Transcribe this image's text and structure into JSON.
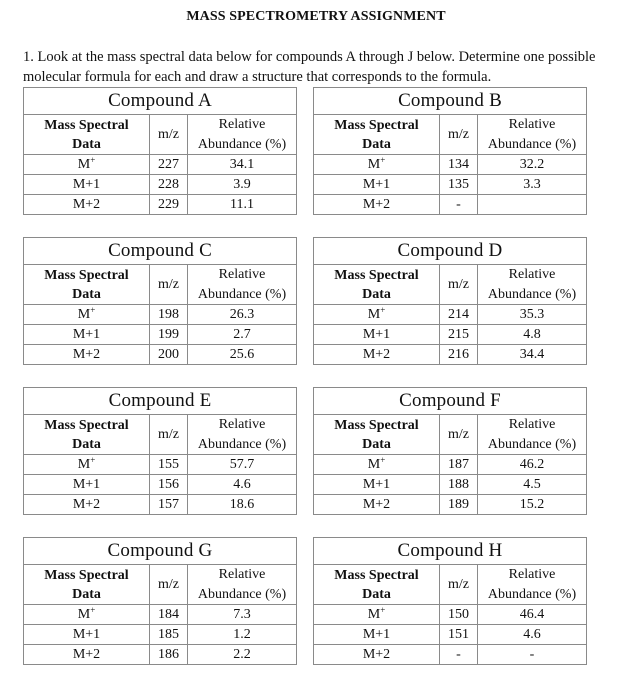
{
  "document": {
    "title": "MASS SPECTROMETRY ASSIGNMENT",
    "instructions": [
      "1. Look at the mass spectral data below for compounds A through J below.  Determine one possible",
      "molecular formula for each and draw a structure that corresponds to the formula."
    ]
  },
  "table_headers": {
    "col1_line1": "Mass Spectral",
    "col1_line2": "Data",
    "col2": "m/z",
    "col3_line1": "Relative",
    "col3_line2": "Abundance (%)"
  },
  "row_labels": {
    "m_base": "M",
    "m_sup": "+",
    "m1": "M+1",
    "m2": "M+2"
  },
  "compounds": [
    {
      "name": "Compound A",
      "rows": [
        {
          "mz": "227",
          "abundance": "34.1"
        },
        {
          "mz": "228",
          "abundance": "3.9"
        },
        {
          "mz": "229",
          "abundance": "11.1"
        }
      ]
    },
    {
      "name": "Compound B",
      "rows": [
        {
          "mz": "134",
          "abundance": "32.2"
        },
        {
          "mz": "135",
          "abundance": "3.3"
        },
        {
          "mz": "-",
          "abundance": ""
        }
      ]
    },
    {
      "name": "Compound C",
      "rows": [
        {
          "mz": "198",
          "abundance": "26.3"
        },
        {
          "mz": "199",
          "abundance": "2.7"
        },
        {
          "mz": "200",
          "abundance": "25.6"
        }
      ]
    },
    {
      "name": "Compound D",
      "rows": [
        {
          "mz": "214",
          "abundance": "35.3"
        },
        {
          "mz": "215",
          "abundance": "4.8"
        },
        {
          "mz": "216",
          "abundance": "34.4"
        }
      ]
    },
    {
      "name": "Compound E",
      "rows": [
        {
          "mz": "155",
          "abundance": "57.7"
        },
        {
          "mz": "156",
          "abundance": "4.6"
        },
        {
          "mz": "157",
          "abundance": "18.6"
        }
      ]
    },
    {
      "name": "Compound F",
      "rows": [
        {
          "mz": "187",
          "abundance": "46.2"
        },
        {
          "mz": "188",
          "abundance": "4.5"
        },
        {
          "mz": "189",
          "abundance": "15.2"
        }
      ]
    },
    {
      "name": "Compound G",
      "rows": [
        {
          "mz": "184",
          "abundance": "7.3"
        },
        {
          "mz": "185",
          "abundance": "1.2"
        },
        {
          "mz": "186",
          "abundance": "2.2"
        }
      ]
    },
    {
      "name": "Compound H",
      "rows": [
        {
          "mz": "150",
          "abundance": "46.4"
        },
        {
          "mz": "151",
          "abundance": "4.6"
        },
        {
          "mz": "-",
          "abundance": "-"
        }
      ]
    }
  ]
}
